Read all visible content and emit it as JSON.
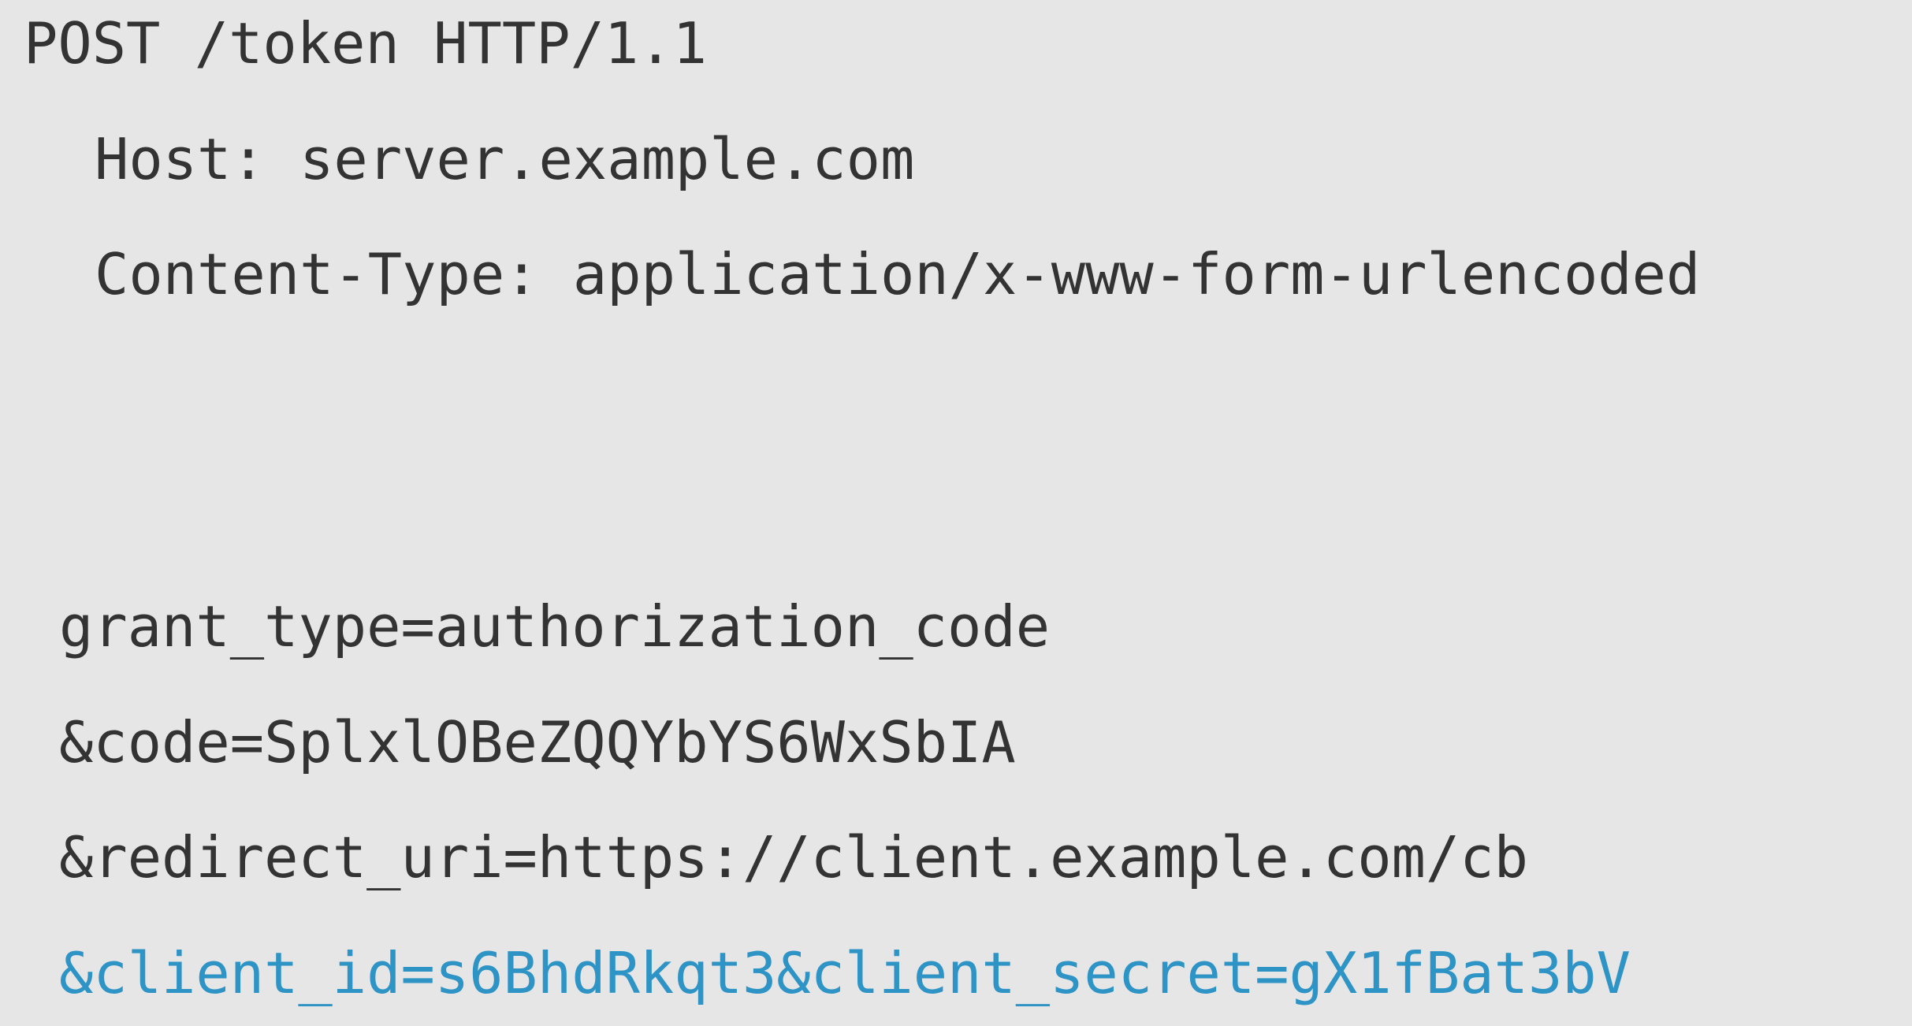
{
  "request": {
    "request_line": "POST /token HTTP/1.1",
    "headers": [
      "Host: server.example.com",
      "Content-Type: application/x-www-form-urlencoded"
    ],
    "body": [
      "grant_type=authorization_code",
      "&code=SplxlOBeZQQYbYS6WxSbIA",
      "&redirect_uri=https://client.example.com/cb",
      "&client_id=s6BhdRkqt3&client_secret=gX1fBat3bV"
    ]
  },
  "colors": {
    "background": "#e6e6e6",
    "text": "#333333",
    "highlight": "#2e93c5"
  }
}
